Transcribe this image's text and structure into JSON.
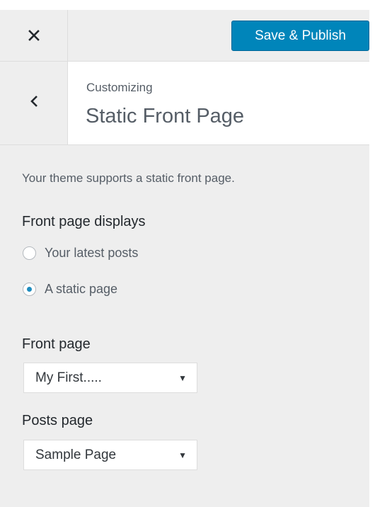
{
  "header": {
    "close_icon": "close-icon",
    "publish_label": "Save & Publish",
    "accent_color": "#0085ba"
  },
  "section": {
    "back_icon": "chevron-left-icon",
    "breadcrumb": "Customizing",
    "title": "Static Front Page"
  },
  "content": {
    "description": "Your theme supports a static front page.",
    "front_page_displays": {
      "label": "Front page displays",
      "options": [
        {
          "label": "Your latest posts",
          "checked": false
        },
        {
          "label": "A static page",
          "checked": true
        }
      ]
    },
    "front_page": {
      "label": "Front page",
      "selected": "My First....."
    },
    "posts_page": {
      "label": "Posts page",
      "selected": "Sample Page"
    }
  }
}
